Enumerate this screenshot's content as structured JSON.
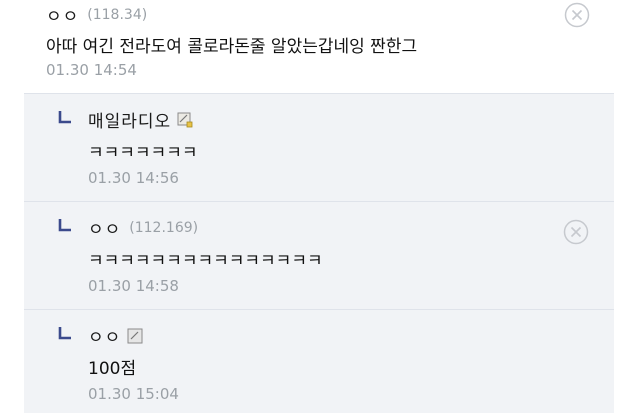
{
  "comments": [
    {
      "nick": "ㅇㅇ",
      "ip": "(118.34)",
      "body": "아따 여긴 전라도여 콜로라돈줄 알았는갑네잉 짠한그",
      "time": "01.30 14:54",
      "deletable": true
    },
    {
      "nick": "매일라디오",
      "ip": "",
      "body": "ㅋㅋㅋㅋㅋㅋㅋ",
      "time": "01.30 14:56",
      "member_icon": "memo-badge-icon"
    },
    {
      "nick": "ㅇㅇ",
      "ip": "(112.169)",
      "body": "ㅋㅋㅋㅋㅋㅋㅋㅋㅋㅋㅋㅋㅋㅋㅋ",
      "time": "01.30 14:58",
      "deletable": true
    },
    {
      "nick": "ㅇㅇ",
      "ip": "",
      "body": "100점",
      "time": "01.30 15:04",
      "member_icon": "memo-badge-icon"
    }
  ],
  "colors": {
    "reply_bg": "#f1f3f6",
    "reply_arrow": "#3b4a8c",
    "meta_text": "#9aa0a6"
  }
}
